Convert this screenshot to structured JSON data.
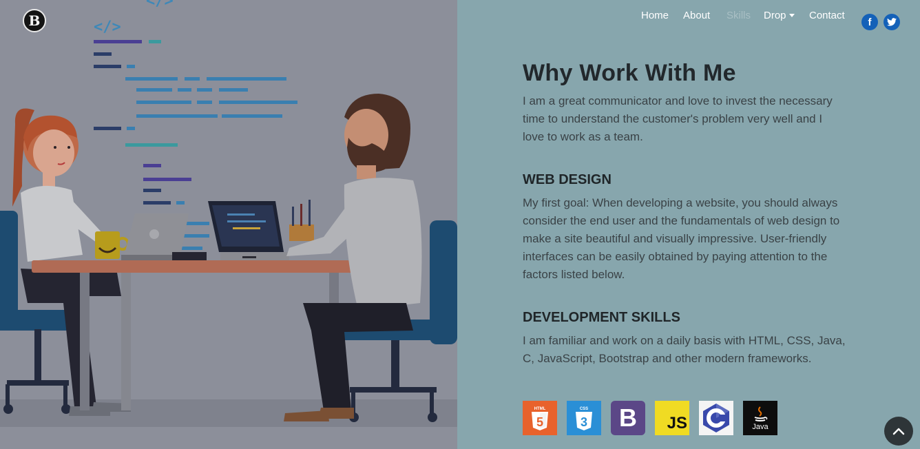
{
  "brand": {
    "logo_letter": "B"
  },
  "nav": {
    "home": "Home",
    "about": "About",
    "skills": "Skills",
    "drop": "Drop",
    "contact": "Contact"
  },
  "social": {
    "facebook": "f"
  },
  "main": {
    "title": "Why Work With Me",
    "intro": "I am a great communicator and love to invest the necessary time to understand the customer's problem very well and I love to work as a team.",
    "web_design": {
      "heading": "WEB DESIGN",
      "text": "My first goal: When developing a website, you should always consider the end user and the fundamentals of web design to make a site beautiful and visually impressive. User-friendly interfaces can be easily obtained by paying attention to the factors listed below."
    },
    "development": {
      "heading": "DEVELOPMENT SKILLS",
      "text": "I am familiar and work on a daily basis with HTML, CSS, Java, C, JavaScript, Bootstrap and other modern frameworks."
    }
  },
  "tech_icons": {
    "html": "HTML",
    "css": "CSS",
    "bootstrap": "B",
    "js": "JS",
    "java": "Java"
  },
  "colors": {
    "panel_bg": "#87a6ad",
    "social_blue": "#1461b8"
  }
}
